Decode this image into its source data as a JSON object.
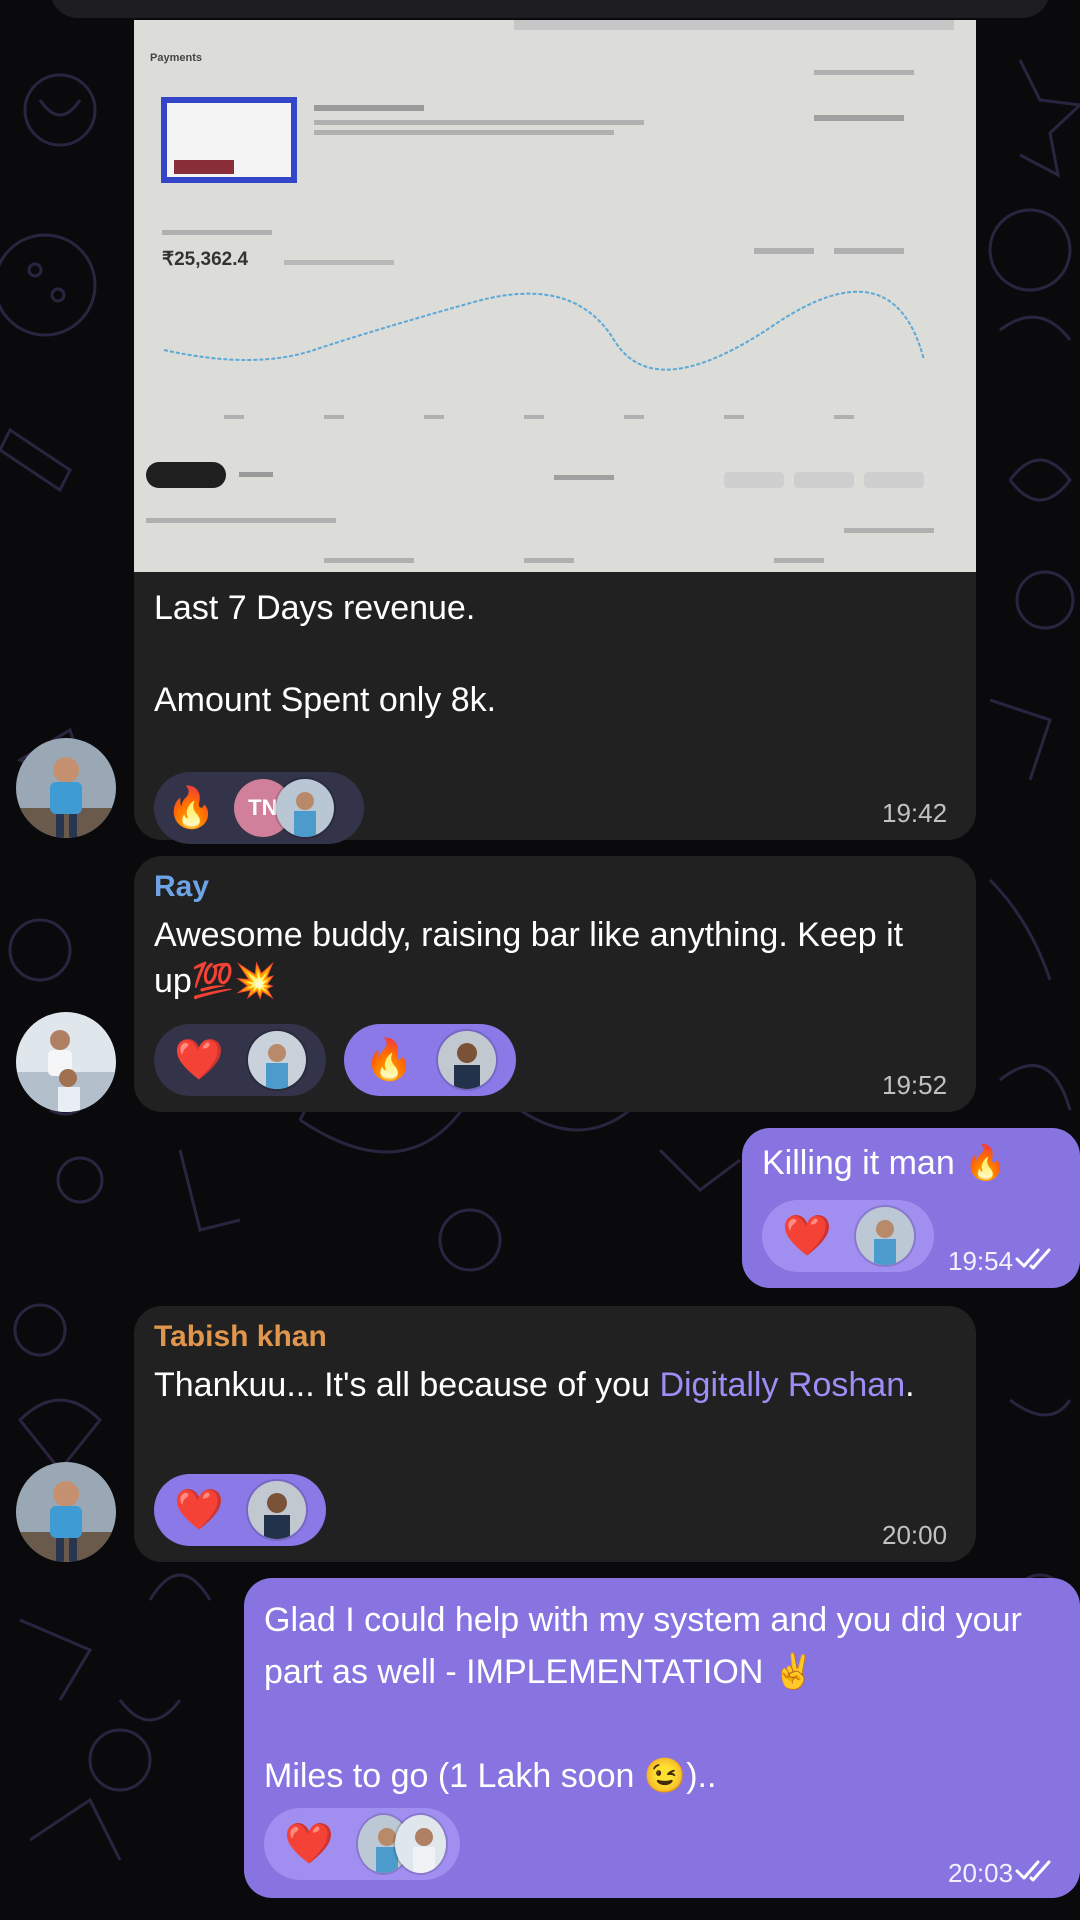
{
  "colors": {
    "background": "#0a0a0c",
    "incoming_bubble": "#212121",
    "outgoing_bubble": "#8774e1",
    "accent": "#8774e1",
    "sender_ray": "#6ea3e6",
    "sender_tabish": "#e0964d",
    "mention_link": "#9b8ef5"
  },
  "messages": [
    {
      "direction": "incoming",
      "photo": {
        "heading": "Payments",
        "amount": "₹25,362.4"
      },
      "text": "Last 7 Days revenue.\n\nAmount Spent only 8k.",
      "reactions": [
        {
          "emoji": "🔥",
          "user_initials": "TN"
        }
      ],
      "time": "19:42"
    },
    {
      "direction": "incoming",
      "sender": "Ray",
      "text": "Awesome buddy, raising bar like anything. Keep it up💯💥",
      "reactions": [
        {
          "emoji": "❤️"
        },
        {
          "emoji": "🔥"
        }
      ],
      "time": "19:52"
    },
    {
      "direction": "outgoing",
      "text": "Killing it man 🔥",
      "reactions": [
        {
          "emoji": "❤️"
        }
      ],
      "time": "19:54"
    },
    {
      "direction": "incoming",
      "sender": "Tabish khan",
      "text_before": "Thankuu... It's all because of you ",
      "mention": "Digitally Roshan",
      "text_after": ".",
      "reactions": [
        {
          "emoji": "❤️"
        }
      ],
      "time": "20:00"
    },
    {
      "direction": "outgoing",
      "text": "Glad I could help with my system and you did your part as well - IMPLEMENTATION ✌️\n\nMiles to go (1 Lakh soon 😉)..",
      "reactions": [
        {
          "emoji": "❤️"
        }
      ],
      "time": "20:03"
    }
  ]
}
